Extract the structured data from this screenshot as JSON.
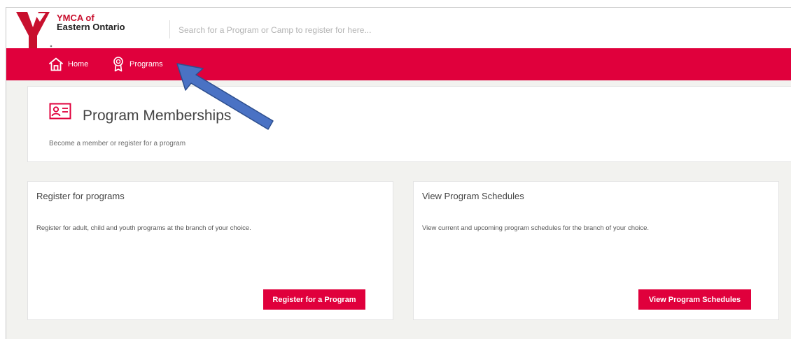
{
  "brand": {
    "line1": "YMCA of",
    "line2": "Eastern Ontario"
  },
  "search": {
    "placeholder": "Search for a Program or Camp to register for here..."
  },
  "nav": {
    "home": "Home",
    "programs": "Programs"
  },
  "header": {
    "title": "Program Memberships",
    "subtitle": "Become a member or register for a program"
  },
  "cards": [
    {
      "title": "Register for programs",
      "description": "Register for adult, child and youth programs at the branch of your choice.",
      "button": "Register for a Program"
    },
    {
      "title": "View Program Schedules",
      "description": "View current and upcoming program schedules for the branch of your choice.",
      "button": "View Program Schedules"
    }
  ],
  "colors": {
    "brand_red": "#e0003c",
    "annotation_arrow": "#4a72c4"
  },
  "icons": [
    "ymca-logo",
    "home-icon",
    "award-icon",
    "membership-card-icon",
    "arrow-annotation"
  ]
}
